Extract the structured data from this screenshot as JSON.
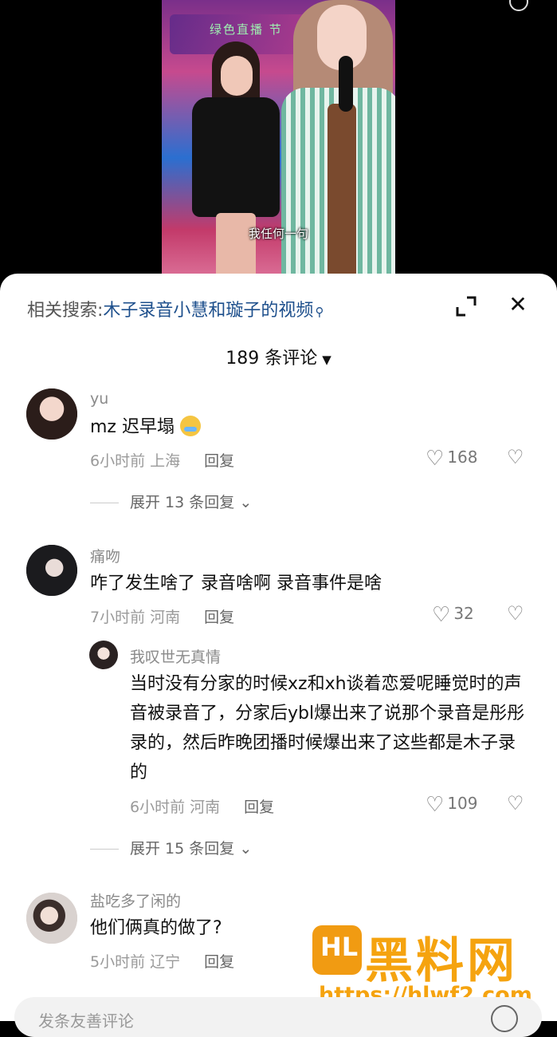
{
  "video": {
    "banner": "绿色直播  节",
    "caption": "我任何一句"
  },
  "panel": {
    "related_prefix": "相关搜索:",
    "related_query": "木子录音小慧和璇子的视频",
    "comment_count": "189 条评论"
  },
  "comments": [
    {
      "user": "yu",
      "text": "mz 迟早塌",
      "time": "6小时前",
      "location": "上海",
      "reply_label": "回复",
      "likes": "168",
      "expand": "展开 13 条回复"
    },
    {
      "user": "痛吻",
      "text": "咋了发生啥了 录音啥啊 录音事件是啥",
      "time": "7小时前",
      "location": "河南",
      "reply_label": "回复",
      "likes": "32"
    },
    {
      "user": "我叹世无真情",
      "text": "当时没有分家的时候xz和xh谈着恋爱呢睡觉时的声音被录音了，分家后ybl爆出来了说那个录音是彤彤录的，然后昨晚团播时候爆出来了这些都是木子录的",
      "time": "6小时前",
      "location": "河南",
      "reply_label": "回复",
      "likes": "109",
      "expand": "展开 15 条回复"
    },
    {
      "user": "盐吃多了闲的",
      "text": "他们俩真的做了?",
      "time": "5小时前",
      "location": "辽宁",
      "reply_label": "回复"
    }
  ],
  "watermark": {
    "title": "黑料网",
    "url": "https://hlwf2.com"
  },
  "input": {
    "placeholder": "发条友善评论"
  }
}
